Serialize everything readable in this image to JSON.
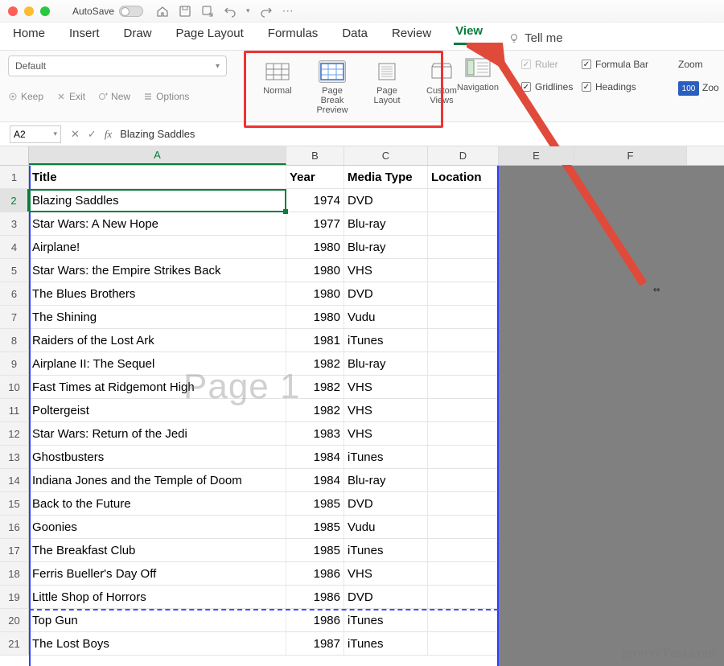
{
  "titlebar": {
    "autosave": "AutoSave"
  },
  "menu": {
    "home": "Home",
    "insert": "Insert",
    "draw": "Draw",
    "page_layout": "Page Layout",
    "formulas": "Formulas",
    "data": "Data",
    "review": "Review",
    "view": "View",
    "tellme": "Tell me"
  },
  "ribbon": {
    "style_default": "Default",
    "keep": "Keep",
    "exit": "Exit",
    "new": "New",
    "options": "Options",
    "normal": "Normal",
    "page_break": "Page Break\nPreview",
    "page_layout": "Page\nLayout",
    "custom_views": "Custom\nViews",
    "navigation": "Navigation",
    "ruler": "Ruler",
    "gridlines": "Gridlines",
    "formula_bar": "Formula Bar",
    "headings": "Headings",
    "zoom": "Zoom",
    "zoom100": "100",
    "zoom_sel": "Zoo"
  },
  "fx": {
    "namebox": "A2",
    "formula": "Blazing Saddles",
    "fx": "fx"
  },
  "columns": [
    "A",
    "B",
    "C",
    "D",
    "E",
    "F"
  ],
  "headers": {
    "title": "Title",
    "year": "Year",
    "media": "Media Type",
    "location": "Location"
  },
  "rows": [
    {
      "n": 1,
      "title": "Title",
      "year": "Year",
      "media": "Media Type",
      "loc": "Location",
      "hdr": true
    },
    {
      "n": 2,
      "title": "Blazing Saddles",
      "year": "1974",
      "media": "DVD",
      "loc": ""
    },
    {
      "n": 3,
      "title": "Star Wars: A New Hope",
      "year": "1977",
      "media": "Blu-ray",
      "loc": ""
    },
    {
      "n": 4,
      "title": "Airplane!",
      "year": "1980",
      "media": "Blu-ray",
      "loc": ""
    },
    {
      "n": 5,
      "title": "Star Wars: the Empire Strikes Back",
      "year": "1980",
      "media": "VHS",
      "loc": ""
    },
    {
      "n": 6,
      "title": "The Blues Brothers",
      "year": "1980",
      "media": "DVD",
      "loc": ""
    },
    {
      "n": 7,
      "title": "The Shining",
      "year": "1980",
      "media": "Vudu",
      "loc": ""
    },
    {
      "n": 8,
      "title": "Raiders of the Lost Ark",
      "year": "1981",
      "media": "iTunes",
      "loc": ""
    },
    {
      "n": 9,
      "title": "Airplane II: The Sequel",
      "year": "1982",
      "media": "Blu-ray",
      "loc": ""
    },
    {
      "n": 10,
      "title": "Fast Times at Ridgemont High",
      "year": "1982",
      "media": "VHS",
      "loc": ""
    },
    {
      "n": 11,
      "title": "Poltergeist",
      "year": "1982",
      "media": "VHS",
      "loc": ""
    },
    {
      "n": 12,
      "title": "Star Wars: Return of the Jedi",
      "year": "1983",
      "media": "VHS",
      "loc": ""
    },
    {
      "n": 13,
      "title": "Ghostbusters",
      "year": "1984",
      "media": "iTunes",
      "loc": ""
    },
    {
      "n": 14,
      "title": "Indiana Jones and the Temple of Doom",
      "year": "1984",
      "media": "Blu-ray",
      "loc": ""
    },
    {
      "n": 15,
      "title": "Back to the Future",
      "year": "1985",
      "media": "DVD",
      "loc": ""
    },
    {
      "n": 16,
      "title": "Goonies",
      "year": "1985",
      "media": "Vudu",
      "loc": ""
    },
    {
      "n": 17,
      "title": "The Breakfast Club",
      "year": "1985",
      "media": "iTunes",
      "loc": ""
    },
    {
      "n": 18,
      "title": "Ferris Bueller's Day Off",
      "year": "1986",
      "media": "VHS",
      "loc": ""
    },
    {
      "n": 19,
      "title": "Little Shop of Horrors",
      "year": "1986",
      "media": "DVD",
      "loc": ""
    },
    {
      "n": 20,
      "title": "Top Gun",
      "year": "1986",
      "media": "iTunes",
      "loc": ""
    },
    {
      "n": 21,
      "title": "The Lost Boys",
      "year": "1987",
      "media": "iTunes",
      "loc": ""
    }
  ],
  "watermark": "Page 1",
  "attribution": "groovyPost.com"
}
